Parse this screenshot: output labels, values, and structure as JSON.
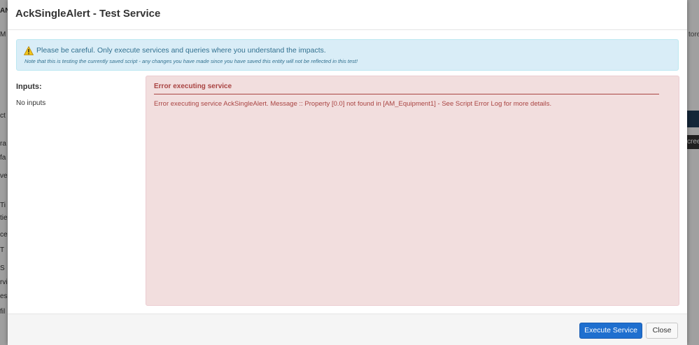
{
  "background": {
    "left_fragments": [
      "AN",
      "M",
      "ct",
      "ra",
      "fa",
      "ve",
      "Ti",
      "tie",
      "ce",
      "T",
      "S",
      "rvi",
      "es",
      "fil"
    ],
    "right_fragments": [
      "tore",
      "cree"
    ]
  },
  "modal": {
    "title": "AckSingleAlert - Test Service",
    "alert": {
      "icon": "warning-icon",
      "main_text": "Please be careful. Only execute services and queries where you understand the impacts.",
      "note_text": "Note that this is testing the currently saved script - any changes you have made since you have saved this entity will not be reflected in this test!"
    },
    "inputs_label": "Inputs:",
    "no_inputs_text": "No inputs",
    "error": {
      "title": "Error executing service",
      "message": "Error executing service AckSingleAlert. Message :: Property [0.0] not found in [AM_Equipment1] - See Script Error Log for more details."
    },
    "footer": {
      "execute_label": "Execute Service",
      "close_label": "Close"
    }
  },
  "colors": {
    "alert_info_bg": "#d9edf7",
    "alert_info_text": "#31708f",
    "error_bg": "#f2dede",
    "error_text": "#a94442",
    "primary_button": "#1f6fcf"
  }
}
